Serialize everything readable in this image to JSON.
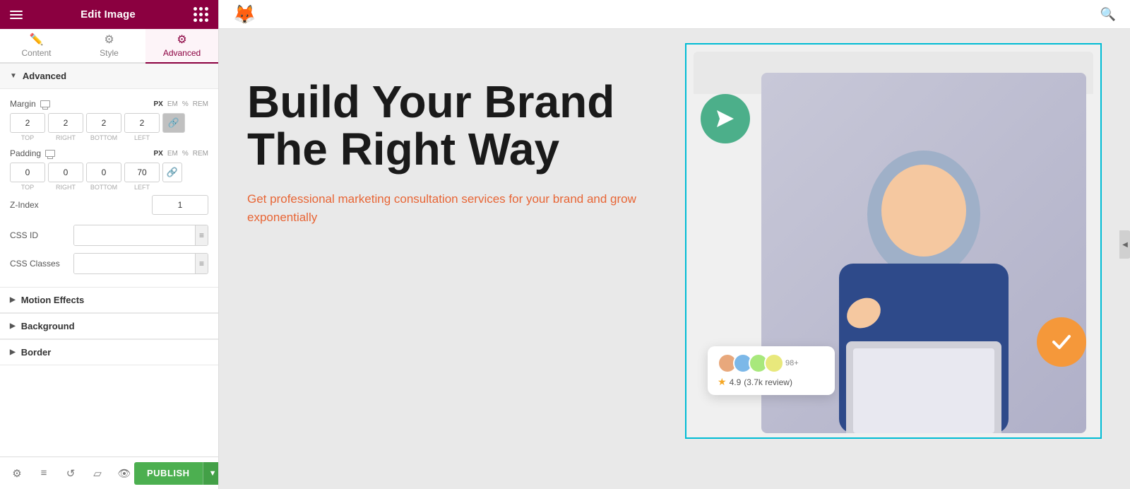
{
  "panel": {
    "title": "Edit Image",
    "tabs": [
      {
        "id": "content",
        "label": "Content",
        "icon": "✏️"
      },
      {
        "id": "style",
        "label": "Style",
        "icon": "⚙️"
      },
      {
        "id": "advanced",
        "label": "Advanced",
        "icon": "⚙️"
      }
    ],
    "active_tab": "advanced",
    "advanced_section": {
      "title": "Advanced",
      "margin": {
        "label": "Margin",
        "units": [
          "PX",
          "EM",
          "%",
          "REM"
        ],
        "active_unit": "PX",
        "top": "2",
        "right": "2",
        "bottom": "2",
        "left": "2"
      },
      "padding": {
        "label": "Padding",
        "units": [
          "PX",
          "EM",
          "%",
          "REM"
        ],
        "active_unit": "PX",
        "top": "0",
        "right": "0",
        "bottom": "0",
        "left": "70"
      },
      "z_index": {
        "label": "Z-Index",
        "value": "1"
      },
      "css_id": {
        "label": "CSS ID",
        "placeholder": ""
      },
      "css_classes": {
        "label": "CSS Classes",
        "placeholder": ""
      }
    },
    "motion_effects": {
      "title": "Motion Effects"
    },
    "background": {
      "title": "Background"
    },
    "border": {
      "title": "Border"
    },
    "bottom": {
      "settings_icon": "⚙",
      "layers_icon": "≡",
      "history_icon": "↺",
      "responsive_icon": "▱",
      "eye_icon": "👁",
      "publish_label": "PUBLISH"
    }
  },
  "canvas": {
    "hero_title": "Build Your Brand The Right Way",
    "hero_subtitle": "Get professional marketing consultation services for your brand and grow exponentially",
    "review": {
      "rating": "4.9",
      "count": "(3.7k review)",
      "avatars_count": "98+"
    }
  }
}
